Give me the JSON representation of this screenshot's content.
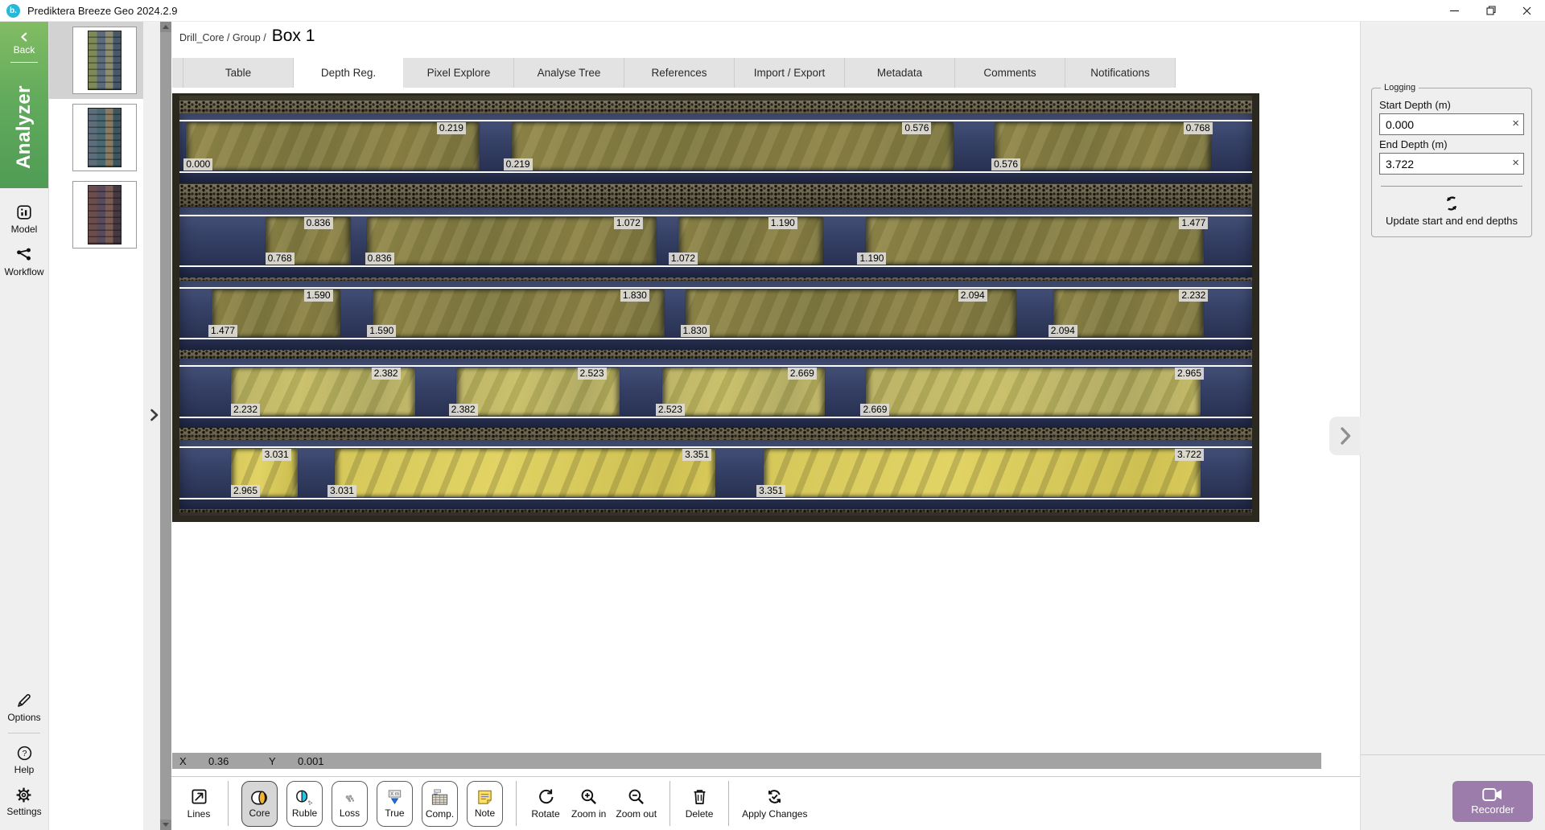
{
  "window": {
    "logo_text": "b.",
    "title": "Prediktera Breeze Geo 2024.2.9"
  },
  "sidebar": {
    "back_label": "Back",
    "mode_label": "Analyzer",
    "nav": [
      {
        "label": "Model",
        "icon": "model-icon"
      },
      {
        "label": "Workflow",
        "icon": "workflow-icon"
      }
    ],
    "footer": [
      {
        "label": "Options",
        "icon": "pencil-icon"
      },
      {
        "label": "Help",
        "icon": "help-icon"
      },
      {
        "label": "Settings",
        "icon": "gear-icon"
      }
    ]
  },
  "thumbnails": [
    {
      "name": "core-box-1",
      "selected": true,
      "palette": [
        "#7e8a55",
        "#5c6b7c",
        "#8d8c6d",
        "#46586b"
      ]
    },
    {
      "name": "core-box-2",
      "selected": false,
      "palette": [
        "#5d6d7c",
        "#49686f",
        "#8a7a60",
        "#3c5560"
      ]
    },
    {
      "name": "core-box-3",
      "selected": false,
      "palette": [
        "#6d4c4c",
        "#594a5c",
        "#7c5c52",
        "#463842"
      ]
    }
  ],
  "breadcrumb": {
    "path": "Drill_Core / Group /",
    "current": "Box 1"
  },
  "tabs": [
    {
      "label": "Table",
      "active": false
    },
    {
      "label": "Depth Reg.",
      "active": true
    },
    {
      "label": "Pixel Explore",
      "active": false
    },
    {
      "label": "Analyse Tree",
      "active": false
    },
    {
      "label": "References",
      "active": false
    },
    {
      "label": "Import / Export",
      "active": false
    },
    {
      "label": "Metadata",
      "active": false
    },
    {
      "label": "Comments",
      "active": false
    },
    {
      "label": "Notifications",
      "active": false
    }
  ],
  "logging": {
    "legend": "Logging",
    "start_label": "Start Depth (m)",
    "start_value": "0.000",
    "end_label": "End Depth (m)",
    "end_value": "3.722",
    "clear_glyph": "×",
    "update_label": "Update start and end depths",
    "update_icon": "refresh-icon"
  },
  "statusbar": {
    "x_label": "X",
    "x_value": "0.36",
    "y_label": "Y",
    "y_value": "0.001"
  },
  "toolbar": {
    "lines": {
      "label": "Lines",
      "icon": "lines-icon"
    },
    "modes": [
      {
        "label": "Core",
        "icon": "core-icon",
        "selected": true
      },
      {
        "label": "Ruble",
        "icon": "ruble-icon",
        "selected": false
      },
      {
        "label": "Loss",
        "icon": "loss-icon",
        "selected": false
      },
      {
        "label": "True",
        "icon": "true-icon",
        "selected": false
      },
      {
        "label": "Comp.",
        "icon": "comp-icon",
        "selected": false
      },
      {
        "label": "Note",
        "icon": "note-icon",
        "selected": false
      }
    ],
    "nav_actions": [
      {
        "label": "Rotate",
        "icon": "rotate-icon"
      },
      {
        "label": "Zoom in",
        "icon": "zoom-in-icon"
      },
      {
        "label": "Zoom out",
        "icon": "zoom-out-icon"
      }
    ],
    "delete": {
      "label": "Delete",
      "icon": "delete-icon"
    },
    "apply": {
      "label": "Apply Changes",
      "icon": "apply-icon"
    },
    "recorder": {
      "label": "Recorder",
      "icon": "video-camera-icon"
    }
  },
  "core_image": {
    "depth_boundaries_m": [
      0.0,
      0.219,
      0.576,
      0.768,
      0.836,
      1.072,
      1.19,
      1.477,
      1.59,
      1.83,
      2.094,
      2.232,
      2.382,
      2.523,
      2.669,
      2.965,
      3.031,
      3.351,
      3.722
    ],
    "rows": [
      {
        "band": [
          6.0,
          18.2
        ],
        "tone": "olive",
        "segments": [
          [
            0.6,
            28.0
          ],
          [
            31.0,
            72.2
          ],
          [
            76.0,
            96.2
          ]
        ],
        "top_labels": [
          {
            "v": "0.219",
            "x": 26.7
          },
          {
            "v": "0.576",
            "x": 70.1
          },
          {
            "v": "0.768",
            "x": 96.3
          }
        ],
        "bottom_labels": [
          {
            "v": "0.000",
            "x": 0.4
          },
          {
            "v": "0.219",
            "x": 30.2
          },
          {
            "v": "0.576",
            "x": 75.7
          }
        ]
      },
      {
        "band": [
          28.5,
          40.7
        ],
        "tone": "olive",
        "segments": [
          [
            8.0,
            16.0
          ],
          [
            17.5,
            44.5
          ],
          [
            46.5,
            60.0
          ],
          [
            64.0,
            95.5
          ]
        ],
        "top_labels": [
          {
            "v": "0.836",
            "x": 14.3
          },
          {
            "v": "1.072",
            "x": 43.2
          },
          {
            "v": "1.190",
            "x": 57.6
          },
          {
            "v": "1.477",
            "x": 95.9
          }
        ],
        "bottom_labels": [
          {
            "v": "0.768",
            "x": 8.0
          },
          {
            "v": "0.836",
            "x": 17.3
          },
          {
            "v": "1.072",
            "x": 45.6
          },
          {
            "v": "1.190",
            "x": 63.2
          }
        ]
      },
      {
        "band": [
          45.8,
          57.9
        ],
        "tone": "olive",
        "segments": [
          [
            3.0,
            15.0
          ],
          [
            18.0,
            45.2
          ],
          [
            47.2,
            78.0
          ],
          [
            81.5,
            95.5
          ]
        ],
        "top_labels": [
          {
            "v": "1.590",
            "x": 14.3
          },
          {
            "v": "1.830",
            "x": 43.8
          },
          {
            "v": "2.094",
            "x": 75.3
          },
          {
            "v": "2.232",
            "x": 95.9
          }
        ],
        "bottom_labels": [
          {
            "v": "1.477",
            "x": 2.7
          },
          {
            "v": "1.590",
            "x": 17.5
          },
          {
            "v": "1.830",
            "x": 46.7
          },
          {
            "v": "2.094",
            "x": 81.0
          }
        ]
      },
      {
        "band": [
          64.4,
          76.6
        ],
        "tone": "yellow-olive",
        "segments": [
          [
            4.8,
            22.0
          ],
          [
            25.8,
            41.0
          ],
          [
            45.0,
            60.2
          ],
          [
            64.0,
            95.2
          ]
        ],
        "top_labels": [
          {
            "v": "2.382",
            "x": 20.6
          },
          {
            "v": "2.523",
            "x": 39.8
          },
          {
            "v": "2.669",
            "x": 59.4
          },
          {
            "v": "2.965",
            "x": 95.5
          }
        ],
        "bottom_labels": [
          {
            "v": "2.232",
            "x": 4.8
          },
          {
            "v": "2.382",
            "x": 25.1
          },
          {
            "v": "2.523",
            "x": 44.4
          },
          {
            "v": "2.669",
            "x": 63.5
          }
        ]
      },
      {
        "band": [
          83.7,
          95.9
        ],
        "tone": "yellow",
        "segments": [
          [
            4.8,
            11.0
          ],
          [
            14.5,
            50.0
          ],
          [
            54.5,
            95.2
          ]
        ],
        "top_labels": [
          {
            "v": "3.031",
            "x": 10.4
          },
          {
            "v": "3.351",
            "x": 49.6
          },
          {
            "v": "3.722",
            "x": 95.5
          }
        ],
        "bottom_labels": [
          {
            "v": "2.965",
            "x": 4.8
          },
          {
            "v": "3.031",
            "x": 13.8
          },
          {
            "v": "3.351",
            "x": 53.8
          }
        ]
      }
    ]
  }
}
